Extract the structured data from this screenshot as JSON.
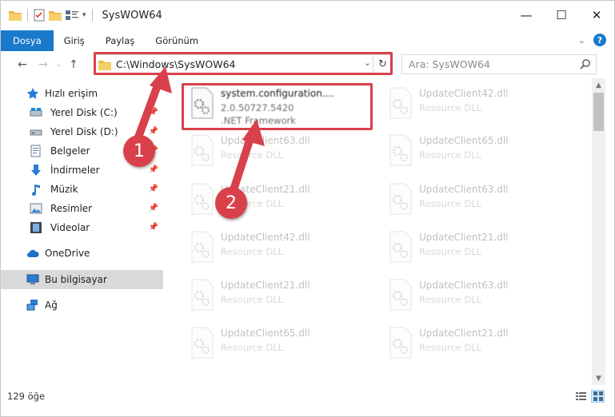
{
  "window": {
    "title": "SysWOW64"
  },
  "ribbon": {
    "tabs": [
      {
        "label": "Dosya"
      },
      {
        "label": "Giriş"
      },
      {
        "label": "Paylaş"
      },
      {
        "label": "Görünüm"
      }
    ]
  },
  "address": {
    "path": "C:\\Windows\\SysWOW64"
  },
  "search": {
    "placeholder": "Ara: SysWOW64"
  },
  "sidebar": {
    "quick_access": "Hızlı erişim",
    "items": [
      {
        "label": "Yerel Disk (C:)"
      },
      {
        "label": "Yerel Disk (D:)"
      },
      {
        "label": "Belgeler"
      },
      {
        "label": "İndirmeler"
      },
      {
        "label": "Müzik"
      },
      {
        "label": "Resimler"
      },
      {
        "label": "Videolar"
      }
    ],
    "onedrive": "OneDrive",
    "this_pc": "Bu bilgisayar",
    "network": "Ağ"
  },
  "files": [
    {
      "name": "system.configuration....",
      "line2": "2.0.50727.5420",
      "line3": ".NET Framework"
    },
    {
      "name": "UpdateClient42.dll",
      "line2": "Resource DLL"
    },
    {
      "name": "UpdateClient63.dll",
      "line2": "Resource DLL"
    },
    {
      "name": "UpdateClient65.dll",
      "line2": "Resource DLL"
    },
    {
      "name": "UpdateClient21.dll",
      "line2": "Resource DLL"
    },
    {
      "name": "UpdateClient63.dll",
      "line2": "Resource DLL"
    },
    {
      "name": "UpdateClient42.dll",
      "line2": "Resource DLL"
    },
    {
      "name": "UpdateClient21.dll",
      "line2": "Resource DLL"
    },
    {
      "name": "UpdateClient21.dll",
      "line2": "Resource DLL"
    },
    {
      "name": "UpdateClient63.dll",
      "line2": "Resource DLL"
    },
    {
      "name": "UpdateClient65.dll",
      "line2": "Resource DLL"
    },
    {
      "name": "UpdateClient21.dll",
      "line2": "Resource DLL"
    }
  ],
  "status": {
    "count": "129 öğe"
  },
  "annotations": {
    "step1": "1",
    "step2": "2",
    "color": "#d9414a"
  },
  "colors": {
    "accent": "#1979ca",
    "selection": "#cce8ff"
  }
}
